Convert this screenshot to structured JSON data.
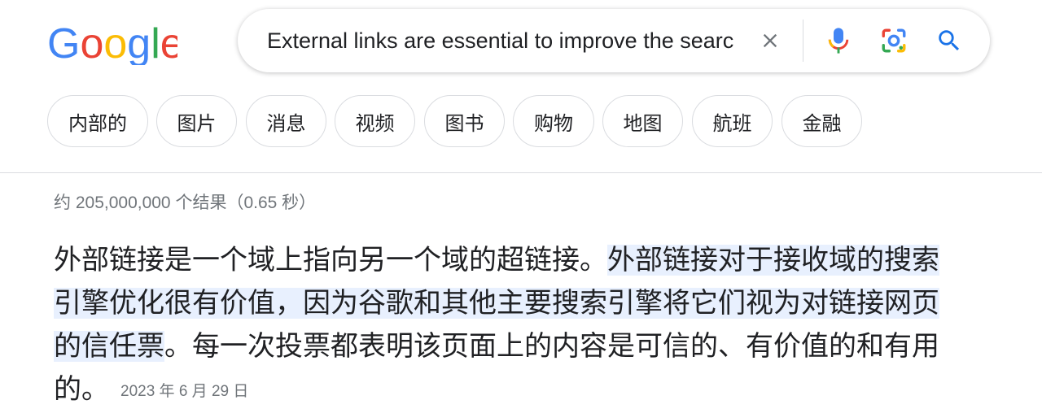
{
  "logo": {
    "text": "Google",
    "colors": [
      "#4285F4",
      "#EA4335",
      "#FBBC05",
      "#4285F4",
      "#34A853",
      "#EA4335"
    ]
  },
  "search": {
    "query": "External links are essential to improve the searc",
    "clear_icon": "close-icon",
    "voice_icon": "mic-icon",
    "lens_icon": "lens-icon",
    "search_icon": "search-icon"
  },
  "chips": [
    {
      "label": "内部的"
    },
    {
      "label": "图片"
    },
    {
      "label": "消息"
    },
    {
      "label": "视频"
    },
    {
      "label": "图书"
    },
    {
      "label": "购物"
    },
    {
      "label": "地图"
    },
    {
      "label": "航班"
    },
    {
      "label": "金融"
    }
  ],
  "results": {
    "stats": "约 205,000,000 个结果（0.65 秒）",
    "snippet": {
      "part1": "外部链接是一个域上指向另一个域的超链接。",
      "highlight": "外部链接对于接收域的搜索引擎优化很有价值，因为谷歌和其他主要搜索引擎将它们视为对链接网页的信任票",
      "part2": "。每一次投票都表明该页面上的内容是可信的、有价值的和有用的。",
      "date": "2023 年 6 月 29 日"
    }
  },
  "colors": {
    "accent": "#1a73e8",
    "highlight": "#e8f0fe",
    "muted": "#70757a",
    "text": "#202124"
  }
}
